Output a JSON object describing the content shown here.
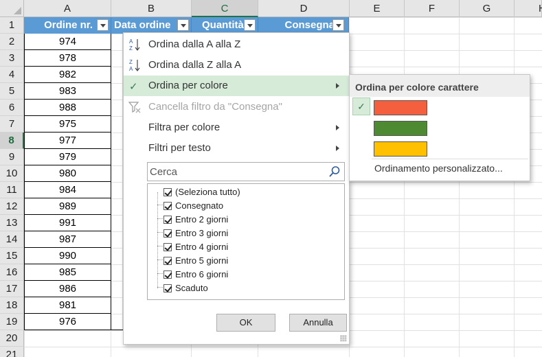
{
  "sheet": {
    "columns": [
      "A",
      "B",
      "C",
      "D",
      "E",
      "F",
      "G",
      "H"
    ],
    "active_column": "C",
    "rows": [
      "1",
      "2",
      "3",
      "4",
      "5",
      "6",
      "7",
      "8",
      "9",
      "10",
      "11",
      "12",
      "13",
      "14",
      "15",
      "16",
      "17",
      "18",
      "19",
      "20",
      "21"
    ],
    "active_row": "9",
    "table_headers": {
      "a": "Ordine nr.",
      "b": "Data ordine",
      "c": "Quantità",
      "d": "Consegna"
    },
    "order_numbers": [
      "974",
      "978",
      "982",
      "983",
      "988",
      "975",
      "977",
      "979",
      "980",
      "984",
      "989",
      "991",
      "987",
      "990",
      "985",
      "986",
      "981",
      "976"
    ]
  },
  "filter_menu": {
    "sort_az": "Ordina dalla A alla Z",
    "sort_za": "Ordina dalla Z alla A",
    "sort_by_color": "Ordina per colore",
    "clear_filter": "Cancella filtro da \"Consegna\"",
    "filter_by_color": "Filtra per colore",
    "text_filters": "Filtri per testo",
    "search_placeholder": "Cerca",
    "values": [
      {
        "label": "(Seleziona tutto)",
        "checked": true
      },
      {
        "label": "Consegnato",
        "checked": true
      },
      {
        "label": "Entro 2 giorni",
        "checked": true
      },
      {
        "label": "Entro 3 giorni",
        "checked": true
      },
      {
        "label": "Entro 4 giorni",
        "checked": true
      },
      {
        "label": "Entro 5 giorni",
        "checked": true
      },
      {
        "label": "Entro 6 giorni",
        "checked": true
      },
      {
        "label": "Scaduto",
        "checked": true
      }
    ],
    "ok": "OK",
    "cancel": "Annulla"
  },
  "sort_color_submenu": {
    "title": "Ordina per colore carattere",
    "swatches": [
      "#f4603e",
      "#4e8a32",
      "#ffc000"
    ],
    "selected_index": 0,
    "custom_sort": "Ordinamento personalizzato..."
  },
  "colors": {
    "table_header_bg": "#5b9bd5",
    "highlight": "#d6ecd9",
    "excel_green": "#217346"
  }
}
